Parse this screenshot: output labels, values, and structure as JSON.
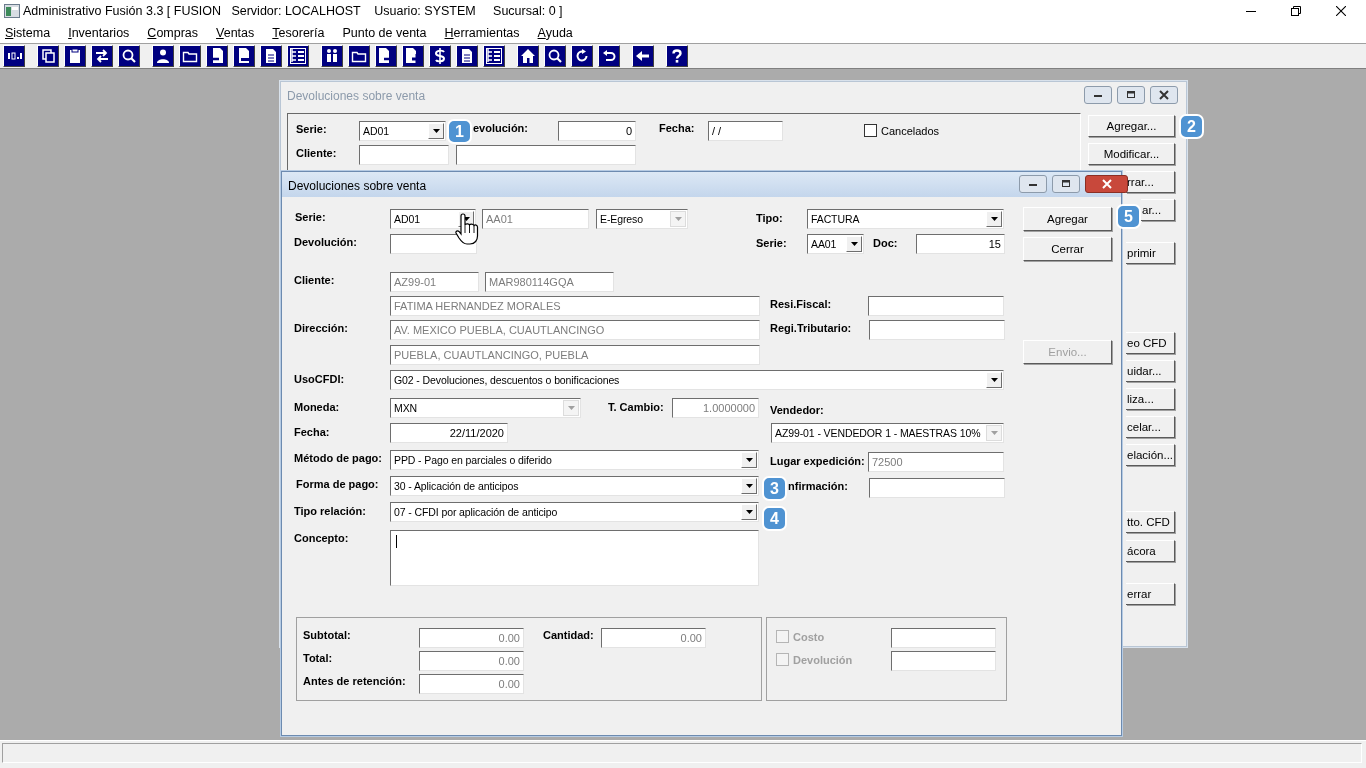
{
  "app": {
    "title": "Administrativo Fusión 3.3 [ FUSION   Servidor: LOCALHOST    Usuario: SYSTEM     Sucursal: 0 ]",
    "menu": [
      {
        "label": "Sistema",
        "mnemonic": true
      },
      {
        "label": "Inventarios",
        "mnemonic": true
      },
      {
        "label": "Compras",
        "mnemonic": true
      },
      {
        "label": "Ventas",
        "mnemonic": true
      },
      {
        "label": "Tesorería",
        "mnemonic": true
      },
      {
        "label": "Punto de venta",
        "mnemonic": false
      },
      {
        "label": "Herramientas",
        "mnemonic": true
      },
      {
        "label": "Ayuda",
        "mnemonic": true
      }
    ]
  },
  "back_window": {
    "title": "Devoluciones sobre venta",
    "controls": [
      {
        "kind": "label",
        "text": "Serie:"
      },
      {
        "kind": "combo",
        "text": "AD01",
        "disabled": false
      },
      {
        "kind": "label",
        "text": "evolución:"
      },
      {
        "kind": "field",
        "text": "0",
        "disabled": false
      },
      {
        "kind": "label",
        "text": "Fecha:"
      },
      {
        "kind": "field",
        "text": "/ /",
        "disabled": false
      },
      {
        "kind": "checkbox",
        "text": "Cancelados",
        "checked": false,
        "disabled": false
      },
      {
        "kind": "label",
        "text": "Cliente:"
      },
      {
        "kind": "field"
      },
      {
        "kind": "field"
      }
    ],
    "buttons": [
      {
        "label": "Agregar...",
        "clipped": false
      },
      {
        "label": "Modificar...",
        "clipped": false
      },
      {
        "label": "rrar...",
        "clipped": true
      },
      {
        "label": "ar...",
        "clipped": true
      },
      {
        "label": "primir",
        "clipped": true
      },
      {
        "label": "eo CFD",
        "clipped": true
      },
      {
        "label": "uidar...",
        "clipped": true
      },
      {
        "label": "liza...",
        "clipped": true
      },
      {
        "label": "celar...",
        "clipped": true
      },
      {
        "label": "elación...",
        "clipped": true
      },
      {
        "label": "tto. CFD",
        "clipped": true
      },
      {
        "label": "ácora",
        "clipped": true
      },
      {
        "label": "errar",
        "clipped": true
      }
    ]
  },
  "front_window": {
    "title": "Devoluciones sobre venta",
    "controls": [
      {
        "kind": "label",
        "text": "Serie:"
      },
      {
        "kind": "combo",
        "text": "AD01",
        "disabled": false
      },
      {
        "kind": "field",
        "text": "AA01",
        "disabled": true
      },
      {
        "kind": "combo",
        "text": "E-Egreso",
        "disabled": true
      },
      {
        "kind": "label",
        "text": "Tipo:"
      },
      {
        "kind": "combo",
        "text": "FACTURA",
        "disabled": false
      },
      {
        "kind": "button",
        "text": "Agregar",
        "disabled": false
      },
      {
        "kind": "label",
        "text": "Devolución:"
      },
      {
        "kind": "field"
      },
      {
        "kind": "label",
        "text": "Serie:"
      },
      {
        "kind": "combo",
        "text": "AA01",
        "disabled": false
      },
      {
        "kind": "label",
        "text": "Doc:"
      },
      {
        "kind": "field",
        "text": "15",
        "disabled": false
      },
      {
        "kind": "button",
        "text": "Cerrar",
        "disabled": false
      },
      {
        "kind": "label",
        "text": "Cliente:"
      },
      {
        "kind": "field",
        "text": "AZ99-01",
        "disabled": true
      },
      {
        "kind": "field",
        "text": "MAR980114GQA",
        "disabled": true
      },
      {
        "kind": "field",
        "text": "FATIMA HERNANDEZ MORALES",
        "disabled": true
      },
      {
        "kind": "label",
        "text": "Resi.Fiscal:"
      },
      {
        "kind": "field"
      },
      {
        "kind": "label",
        "text": "Dirección:"
      },
      {
        "kind": "field",
        "text": "AV. MEXICO PUEBLA, CUAUTLANCINGO",
        "disabled": true
      },
      {
        "kind": "label",
        "text": "Regi.Tributario:"
      },
      {
        "kind": "field"
      },
      {
        "kind": "field",
        "text": "PUEBLA, CUAUTLANCINGO, PUEBLA",
        "disabled": true
      },
      {
        "kind": "button",
        "text": "Envio...",
        "disabled": true
      },
      {
        "kind": "label",
        "text": "UsoCFDI:"
      },
      {
        "kind": "combo",
        "text": "G02 - Devoluciones, descuentos o bonificaciones",
        "disabled": false
      },
      {
        "kind": "label",
        "text": "Moneda:"
      },
      {
        "kind": "combo",
        "text": "MXN",
        "disabled": true
      },
      {
        "kind": "label",
        "text": "T. Cambio:"
      },
      {
        "kind": "field",
        "text": "1.0000000",
        "disabled": true
      },
      {
        "kind": "label",
        "text": "Vendedor:"
      },
      {
        "kind": "label",
        "text": "Fecha:"
      },
      {
        "kind": "field",
        "text": "22/11/2020",
        "disabled": false
      },
      {
        "kind": "combo",
        "text": "AZ99-01 - VENDEDOR 1 - MAESTRAS 10%",
        "disabled": true
      },
      {
        "kind": "label",
        "text": "Método de pago:"
      },
      {
        "kind": "combo",
        "text": "PPD - Pago en parciales o diferido",
        "disabled": false
      },
      {
        "kind": "label",
        "text": "Lugar expedición:"
      },
      {
        "kind": "field",
        "text": "72500",
        "disabled": true
      },
      {
        "kind": "label",
        "text": "Forma de pago:"
      },
      {
        "kind": "combo",
        "text": "30 - Aplicación de anticipos",
        "disabled": false
      },
      {
        "kind": "label",
        "text": "nfirmación:"
      },
      {
        "kind": "field"
      },
      {
        "kind": "label",
        "text": "Tipo relación:"
      },
      {
        "kind": "combo",
        "text": "07 - CFDI por aplicación de anticipo",
        "disabled": false
      },
      {
        "kind": "label",
        "text": "Concepto:"
      },
      {
        "kind": "textarea"
      },
      {
        "kind": "label",
        "text": "Subtotal:"
      },
      {
        "kind": "field",
        "text": "0.00",
        "disabled": true
      },
      {
        "kind": "label",
        "text": "Cantidad:"
      },
      {
        "kind": "field",
        "text": "0.00",
        "disabled": true
      },
      {
        "kind": "label",
        "text": "Total:"
      },
      {
        "kind": "field",
        "text": "0.00",
        "disabled": true
      },
      {
        "kind": "label",
        "text": "Antes de retención:"
      },
      {
        "kind": "field",
        "text": "0.00",
        "disabled": true
      },
      {
        "kind": "checkbox",
        "text": "Costo",
        "checked": false,
        "disabled": true
      },
      {
        "kind": "field"
      },
      {
        "kind": "checkbox",
        "text": "Devolución",
        "checked": false,
        "disabled": true
      },
      {
        "kind": "field"
      }
    ]
  },
  "callouts": [
    {
      "label": "1"
    },
    {
      "label": "2"
    },
    {
      "label": "3"
    },
    {
      "label": "4"
    },
    {
      "label": "5"
    }
  ]
}
